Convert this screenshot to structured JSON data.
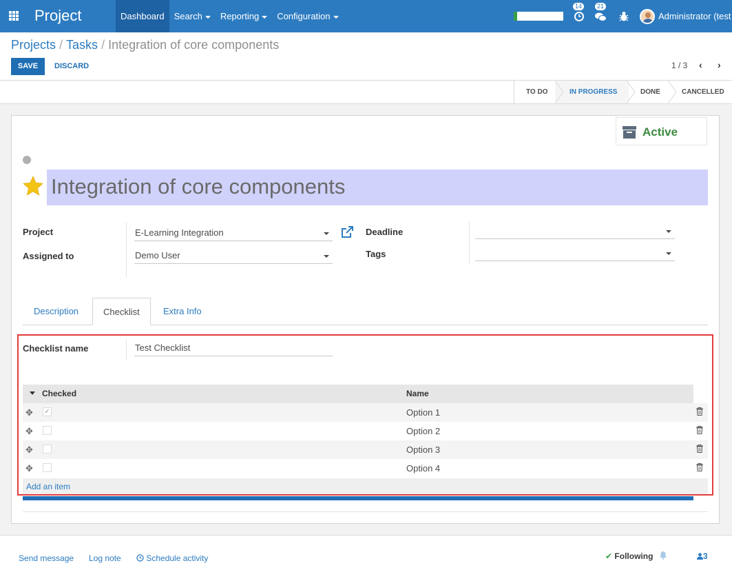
{
  "navbar": {
    "app_name": "Project",
    "menus": [
      {
        "label": "Dashboard"
      },
      {
        "label": "Search"
      },
      {
        "label": "Reporting"
      },
      {
        "label": "Configuration"
      }
    ],
    "activity_count": "14",
    "message_count": "21",
    "user": "Administrator (test",
    "progress": 0.07,
    "brand_color": "#2c7bc0"
  },
  "breadcrumb": {
    "projects": "Projects",
    "tasks": "Tasks",
    "current": "Integration of core components",
    "sep": "/"
  },
  "buttons": {
    "save": "SAVE",
    "discard": "DISCARD"
  },
  "pager": {
    "value": "1 / 3",
    "prev": "‹",
    "next": "›"
  },
  "stages": [
    "TO DO",
    "IN PROGRESS",
    "DONE",
    "CANCELLED"
  ],
  "current_stage": "IN PROGRESS",
  "form": {
    "active_label": "Active",
    "title": "Integration of core components",
    "project_label": "Project",
    "project_value": "E-Learning Integration",
    "assigned_label": "Assigned to",
    "assigned_value": "Demo User",
    "deadline_label": "Deadline",
    "deadline_value": "",
    "tags_label": "Tags",
    "tags_value": ""
  },
  "tabs": [
    "Description",
    "Checklist",
    "Extra Info"
  ],
  "active_tab": "Checklist",
  "checklist": {
    "name_label": "Checklist name",
    "name_value": "Test Checklist",
    "col_checked": "Checked",
    "col_name": "Name",
    "rows": [
      {
        "checked": "✓",
        "name": "Option 1"
      },
      {
        "checked": "",
        "name": "Option 2"
      },
      {
        "checked": "",
        "name": "Option 3"
      },
      {
        "checked": "",
        "name": "Option 4"
      }
    ],
    "add_item": "Add an item"
  },
  "chatter": {
    "send_message": "Send message",
    "log_note": "Log note",
    "schedule": "Schedule activity",
    "following": "Following",
    "followers": "3"
  }
}
